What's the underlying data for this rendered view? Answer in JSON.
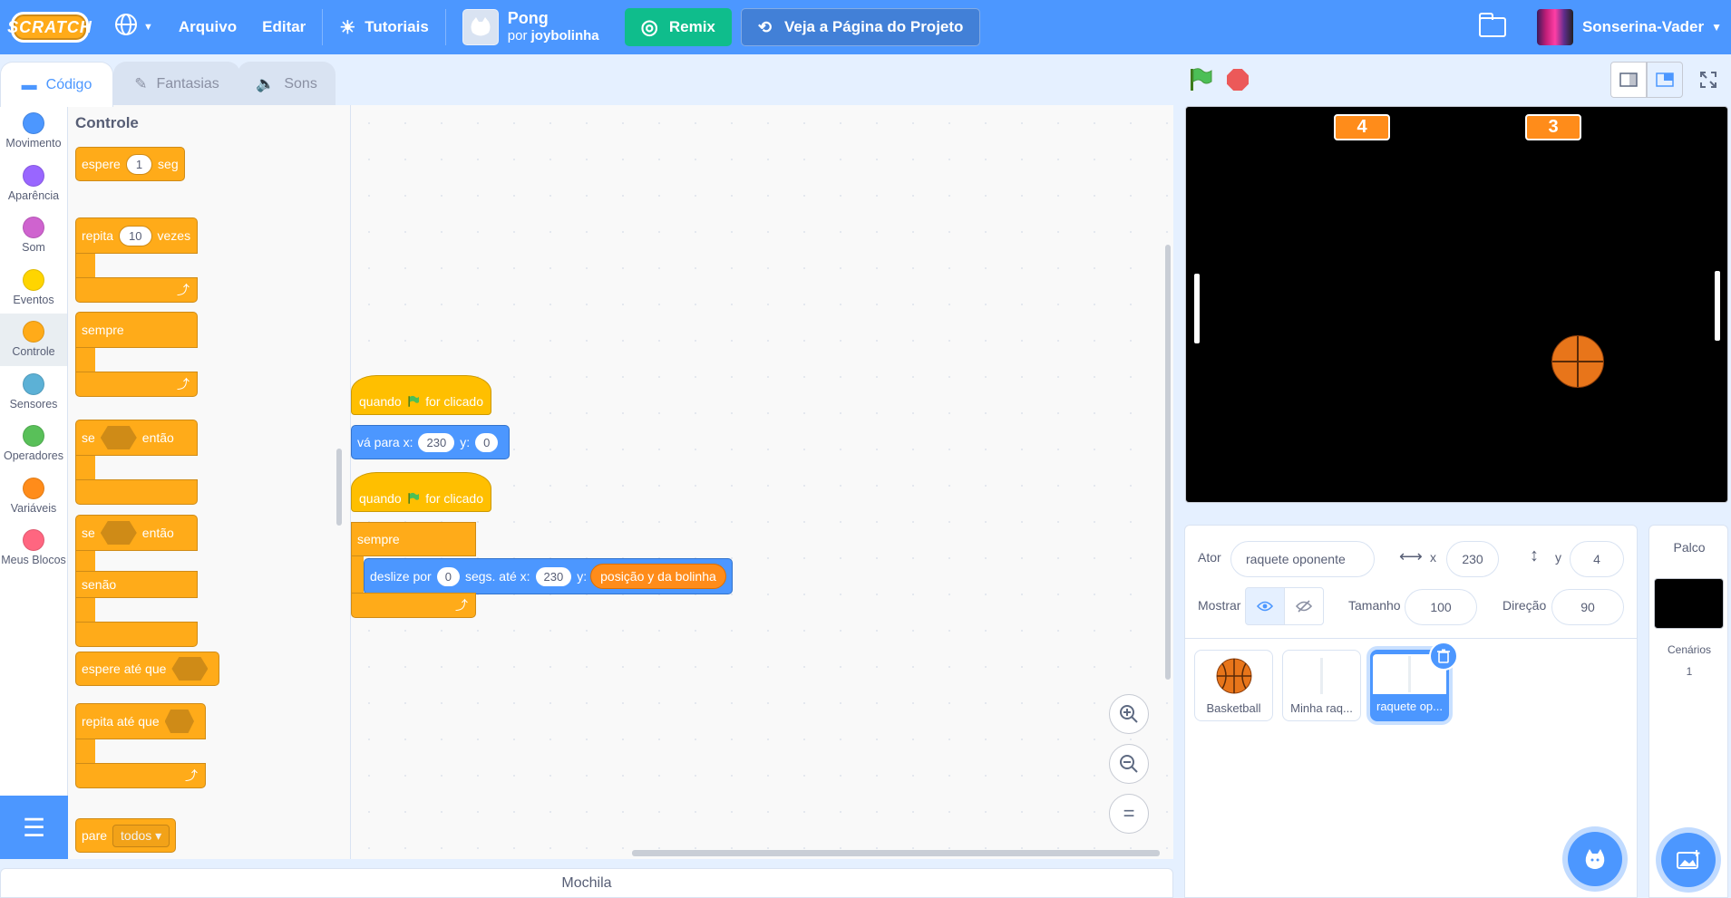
{
  "menubar": {
    "logo": "SCRATCH",
    "file": "Arquivo",
    "edit": "Editar",
    "tutorials": "Tutoriais",
    "project_title": "Pong",
    "project_by": "por",
    "project_author": "joybolinha",
    "remix": "Remix",
    "see_project_page": "Veja a Página do Projeto",
    "username": "Sonserina-Vader"
  },
  "tabs": {
    "code": "Código",
    "costumes": "Fantasias",
    "sounds": "Sons"
  },
  "categories": [
    {
      "label": "Movimento",
      "color": "#4c97ff"
    },
    {
      "label": "Aparência",
      "color": "#9966ff"
    },
    {
      "label": "Som",
      "color": "#cf63cf"
    },
    {
      "label": "Eventos",
      "color": "#ffd500"
    },
    {
      "label": "Controle",
      "color": "#ffab19"
    },
    {
      "label": "Sensores",
      "color": "#5cb1d6"
    },
    {
      "label": "Operadores",
      "color": "#59c059"
    },
    {
      "label": "Variáveis",
      "color": "#ff8c1a"
    },
    {
      "label": "Meus Blocos",
      "color": "#ff6680"
    }
  ],
  "flyout": {
    "title": "Controle",
    "wait": "espere",
    "wait_value": "1",
    "wait_unit": "seg",
    "repeat": "repita",
    "repeat_value": "10",
    "repeat_unit": "vezes",
    "forever": "sempre",
    "if": "se",
    "then": "então",
    "if2": "se",
    "then2": "então",
    "else": "senão",
    "wait_until": "espere até que",
    "repeat_until": "repita até que",
    "stop": "pare",
    "stop_option": "todos"
  },
  "scripts": {
    "when": "quando",
    "clicked": "for clicado",
    "goto_label": "vá para x:",
    "goto_x": "230",
    "goto_y_label": "y:",
    "goto_y": "0",
    "when2": "quando",
    "clicked2": "for clicado",
    "forever": "sempre",
    "glide_label": "deslize por",
    "glide_secs": "0",
    "glide_to_x": "segs. até x:",
    "glide_x": "230",
    "glide_y_label": "y:",
    "glide_y_reporter": "posição y da bolinha"
  },
  "backpack": "Mochila",
  "stage": {
    "score_left": "4",
    "score_right": "3"
  },
  "sprite_info": {
    "sprite_label": "Ator",
    "sprite_name": "raquete oponente",
    "x_label": "x",
    "x": "230",
    "y_label": "y",
    "y": "4",
    "show_label": "Mostrar",
    "size_label": "Tamanho",
    "size": "100",
    "direction_label": "Direção",
    "direction": "90"
  },
  "sprites": [
    {
      "name": "Basketball"
    },
    {
      "name": "Minha raq..."
    },
    {
      "name": "raquete op..."
    }
  ],
  "stage_pane": {
    "title": "Palco",
    "backdrops_label": "Cenários",
    "backdrops_count": "1"
  }
}
